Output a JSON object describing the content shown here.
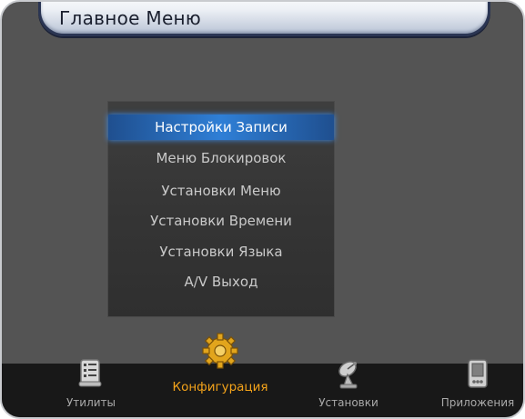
{
  "header": {
    "title": "Главное Меню"
  },
  "menu": {
    "items": [
      {
        "label": "Настройки Записи",
        "selected": true
      },
      {
        "label": "Меню Блокировок",
        "selected": false
      },
      {
        "label": "Установки Меню",
        "selected": false
      },
      {
        "label": "Установки Времени",
        "selected": false
      },
      {
        "label": "Установки Языка",
        "selected": false
      },
      {
        "label": "A/V Выход",
        "selected": false
      }
    ]
  },
  "tabs": [
    {
      "label": "Утилиты",
      "icon": "utilities-icon",
      "active": false
    },
    {
      "label": "Конфигурация",
      "icon": "configuration-gear-icon",
      "active": true
    },
    {
      "label": "Установки",
      "icon": "installation-satellite-icon",
      "active": false
    },
    {
      "label": "Приложения",
      "icon": "applications-pda-icon",
      "active": false
    }
  ],
  "colors": {
    "selection": "#2f7fd6",
    "active_tab_label": "#f2a21a",
    "background": "#545454",
    "title_border": "#2a3553"
  }
}
